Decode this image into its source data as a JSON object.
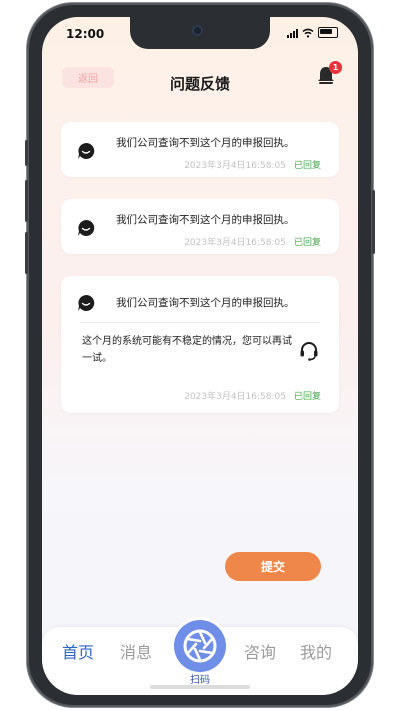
{
  "status_bar": {
    "time": "12:00"
  },
  "header": {
    "back_label": "返回",
    "title": "问题反馈",
    "notification_count": "1"
  },
  "feedback_items": [
    {
      "question": "我们公司查询不到这个月的申报回执。",
      "timestamp": "2023年3月4日16:58:05",
      "status": "已回复"
    },
    {
      "question": "我们公司查询不到这个月的申报回执。",
      "timestamp": "2023年3月4日16:58:05",
      "status": "已回复"
    },
    {
      "question": "我们公司查询不到这个月的申报回执。",
      "reply": "这个月的系统可能有不稳定的情况，您可以再试一试。",
      "timestamp": "2023年3月4日16:58:05",
      "status": "已回复"
    }
  ],
  "submit_label": "提交",
  "tabbar": {
    "tabs": [
      "首页",
      "消息",
      "扫码",
      "咨询",
      "我的"
    ]
  },
  "colors": {
    "accent_orange": "#f0874a",
    "replied_green": "#47a44b",
    "active_tab_blue": "#2f66c8",
    "scan_blue": "#6f8ee8",
    "badge_red": "#e8333a"
  }
}
